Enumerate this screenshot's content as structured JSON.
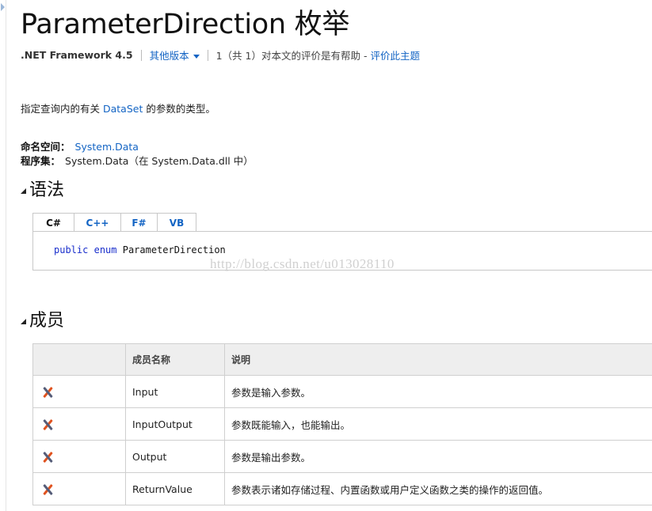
{
  "page": {
    "title": "ParameterDirection 枚举"
  },
  "meta": {
    "framework": ".NET Framework 4.5",
    "other_versions": "其他版本",
    "rating_text": "1（共 1）对本文的评价是有帮助 -",
    "rate_link": "评价此主题"
  },
  "description": {
    "prefix": "指定查询内的有关 ",
    "link": "DataSet",
    "suffix": " 的参数的类型。"
  },
  "namespace": {
    "label": "命名空间：",
    "value": "System.Data"
  },
  "assembly": {
    "label": "程序集：",
    "value": "System.Data（在 System.Data.dll 中）"
  },
  "syntax": {
    "heading": "语法",
    "tabs": [
      {
        "label": "C#"
      },
      {
        "label": "C++"
      },
      {
        "label": "F#"
      },
      {
        "label": "VB"
      }
    ],
    "active_tab": "C#",
    "code_kw1": "public",
    "code_kw2": "enum",
    "code_name": "ParameterDirection"
  },
  "watermark": "http://blog.csdn.net/u013028110",
  "members": {
    "heading": "成员",
    "columns": [
      "",
      "成员名称",
      "说明"
    ],
    "rows": [
      {
        "name": "Input",
        "desc": "参数是输入参数。"
      },
      {
        "name": "InputOutput",
        "desc": "参数既能输入，也能输出。"
      },
      {
        "name": "Output",
        "desc": "参数是输出参数。"
      },
      {
        "name": "ReturnValue",
        "desc": "参数表示诸如存储过程、内置函数或用户定义函数之类的操作的返回值。"
      }
    ]
  },
  "colors": {
    "link": "#1364c4",
    "keyword": "#1a2fcc",
    "header_bg": "#eeeeee",
    "icon_orange": "#e0531f",
    "icon_slate": "#555c78"
  }
}
